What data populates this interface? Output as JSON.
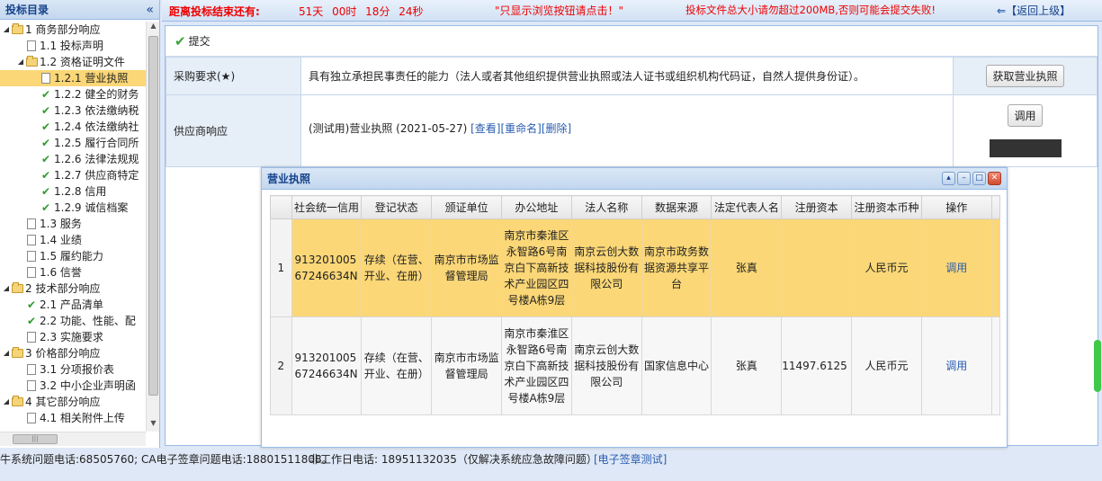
{
  "sidebar": {
    "title": "投标目录",
    "collapse_icon": "«",
    "items": [
      {
        "label": "1 商务部分响应",
        "icon": "folder",
        "expanded": "◢",
        "level": 0
      },
      {
        "label": "1.1 投标声明",
        "icon": "doc",
        "level": 1
      },
      {
        "label": "1.2 资格证明文件",
        "icon": "folder",
        "expanded": "◢",
        "level": 1
      },
      {
        "label": "1.2.1 营业执照",
        "icon": "doc",
        "level": 2,
        "selected": true
      },
      {
        "label": "1.2.2 健全的财务",
        "icon": "check",
        "level": 2
      },
      {
        "label": "1.2.3 依法缴纳税",
        "icon": "check",
        "level": 2
      },
      {
        "label": "1.2.4 依法缴纳社",
        "icon": "check",
        "level": 2
      },
      {
        "label": "1.2.5 履行合同所",
        "icon": "check",
        "level": 2
      },
      {
        "label": "1.2.6 法律法规规",
        "icon": "check",
        "level": 2
      },
      {
        "label": "1.2.7 供应商特定",
        "icon": "check",
        "level": 2
      },
      {
        "label": "1.2.8 信用",
        "icon": "check",
        "level": 2
      },
      {
        "label": "1.2.9 诚信档案",
        "icon": "check",
        "level": 2
      },
      {
        "label": "1.3 服务",
        "icon": "doc",
        "level": 1
      },
      {
        "label": "1.4 业绩",
        "icon": "doc",
        "level": 1
      },
      {
        "label": "1.5 履约能力",
        "icon": "doc",
        "level": 1
      },
      {
        "label": "1.6 信誉",
        "icon": "doc",
        "level": 1
      },
      {
        "label": "2 技术部分响应",
        "icon": "folder",
        "expanded": "◢",
        "level": 0
      },
      {
        "label": "2.1 产品清单",
        "icon": "check",
        "level": 1
      },
      {
        "label": "2.2 功能、性能、配",
        "icon": "check",
        "level": 1
      },
      {
        "label": "2.3 实施要求",
        "icon": "doc",
        "level": 1
      },
      {
        "label": "3 价格部分响应",
        "icon": "folder",
        "expanded": "◢",
        "level": 0
      },
      {
        "label": "3.1 分项报价表",
        "icon": "doc",
        "level": 1
      },
      {
        "label": "3.2 中小企业声明函",
        "icon": "doc",
        "level": 1
      },
      {
        "label": "4 其它部分响应",
        "icon": "folder",
        "expanded": "◢",
        "level": 0
      },
      {
        "label": "4.1 相关附件上传",
        "icon": "doc",
        "level": 1
      }
    ]
  },
  "topbar": {
    "countdown_label": "距离投标结束还有:",
    "countdown": "51天 00时 18分 24秒",
    "notice": "\"只显示浏览按钮请点击！\"",
    "size_warning": "投标文件总大小请勿超过200MB,否则可能会提交失败!",
    "back_label": "【返回上级】"
  },
  "toolbar": {
    "submit_label": "提交"
  },
  "form": {
    "row1_label": "采购要求(★)",
    "row1_value": "具有独立承担民事责任的能力（法人或者其他组织提供营业执照或法人证书或组织机构代码证，自然人提供身份证）。",
    "row1_button": "获取营业执照",
    "row2_label": "供应商响应",
    "row2_file": "(测试用)营业执照 (2021-05-27)",
    "row2_view": "[查看]",
    "row2_rename": "[重命名]",
    "row2_delete": "[删除]",
    "row2_button": "调用"
  },
  "popup": {
    "title": "营业执照",
    "columns": [
      "社会统一信用",
      "登记状态",
      "颁证单位",
      "办公地址",
      "法人名称",
      "数据来源",
      "法定代表人名",
      "注册资本",
      "注册资本币种",
      "操作"
    ],
    "rows": [
      {
        "index": "1",
        "credit": "91320100567246634N",
        "status": "存续（在营、开业、在册）",
        "authority": "南京市市场监督管理局",
        "address": "南京市秦淮区永智路6号南京白下高新技术产业园区四号楼A栋9层",
        "company": "南京云创大数据科技股份有限公司",
        "source": "南京市政务数据资源共享平台",
        "rep": "张真",
        "capital": "",
        "currency": "人民币元",
        "action": "调用",
        "highlight": true
      },
      {
        "index": "2",
        "credit": "91320100567246634N",
        "status": "存续（在营、开业、在册）",
        "authority": "南京市市场监督管理局",
        "address": "南京市秦淮区永智路6号南京白下高新技术产业园区四号楼A栋9层",
        "company": "南京云创大数据科技股份有限公司",
        "source": "国家信息中心",
        "rep": "张真",
        "capital": "11497.6125",
        "currency": "人民币元",
        "action": "调用",
        "highlight": false
      }
    ]
  },
  "footer": {
    "phones": "牛系统问题电话:68505760; CA电子签章问题电话:18801511808。",
    "offday": "非工作日电话: 18951132035（仅解决系统应急故障问题）",
    "sign_test": "[电子签章测试]"
  },
  "colors": {
    "highlight": "#fbd777",
    "accent": "#15428b",
    "warning": "#e00000",
    "link": "#2a5db0"
  }
}
